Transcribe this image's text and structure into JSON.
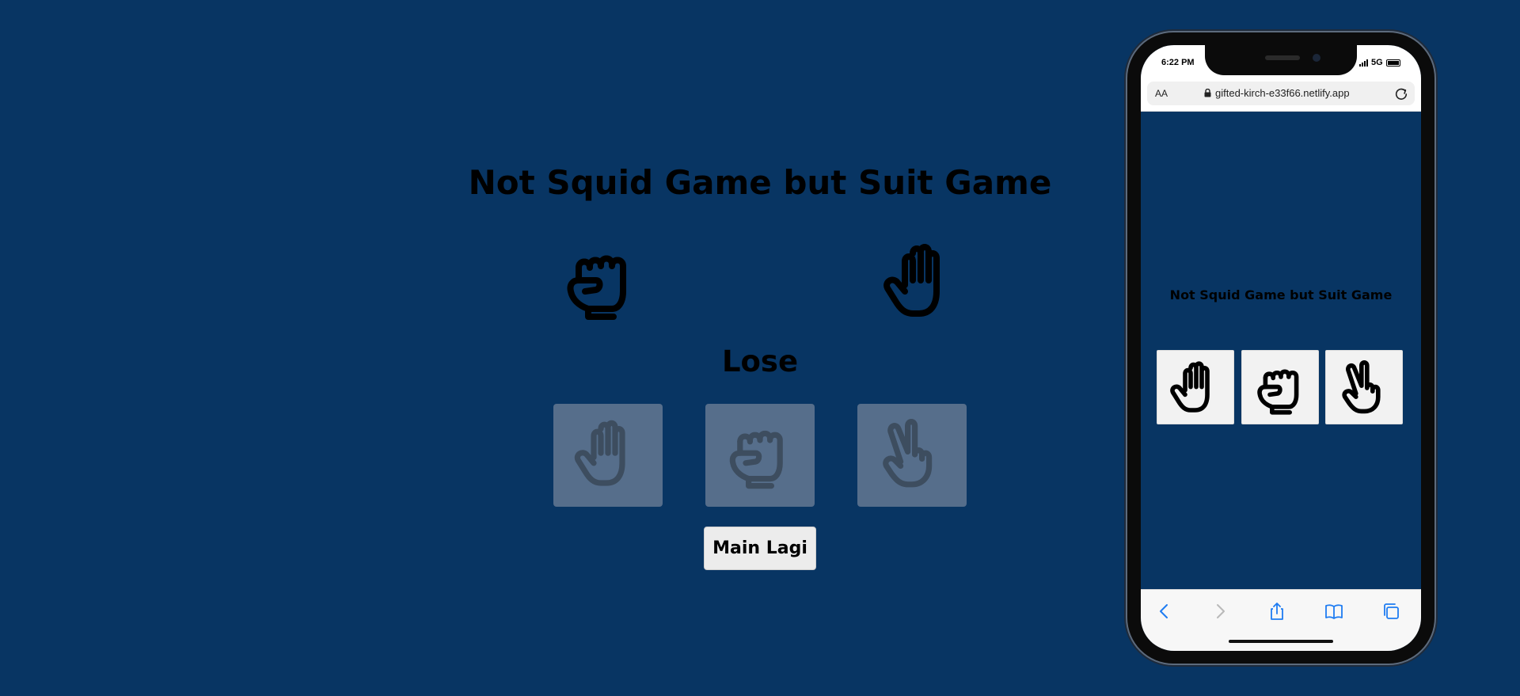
{
  "game": {
    "title": "Not Squid Game but Suit Game",
    "result": "Lose",
    "player_hand": "fist-icon",
    "computer_hand": "open-hand-icon",
    "choices": [
      {
        "name": "paper",
        "icon": "open-hand-icon"
      },
      {
        "name": "rock",
        "icon": "fist-icon"
      },
      {
        "name": "scissors",
        "icon": "peace-hand-icon"
      }
    ],
    "replay_label": "Main Lagi"
  },
  "phone": {
    "status_time": "6:22 PM",
    "network": "5G",
    "browser": {
      "aa_label": "AA",
      "url": "gifted-kirch-e33f66.netlify.app"
    },
    "page_title": "Not Squid Game but Suit Game",
    "choices": [
      "open-hand-icon",
      "fist-icon",
      "peace-hand-icon"
    ],
    "toolbar": [
      "back-icon",
      "forward-icon",
      "share-icon",
      "bookmarks-icon",
      "tabs-icon"
    ]
  },
  "colors": {
    "background": "#083563",
    "choice_button_disabled": "#566e8b",
    "replay_button": "#ececec"
  }
}
